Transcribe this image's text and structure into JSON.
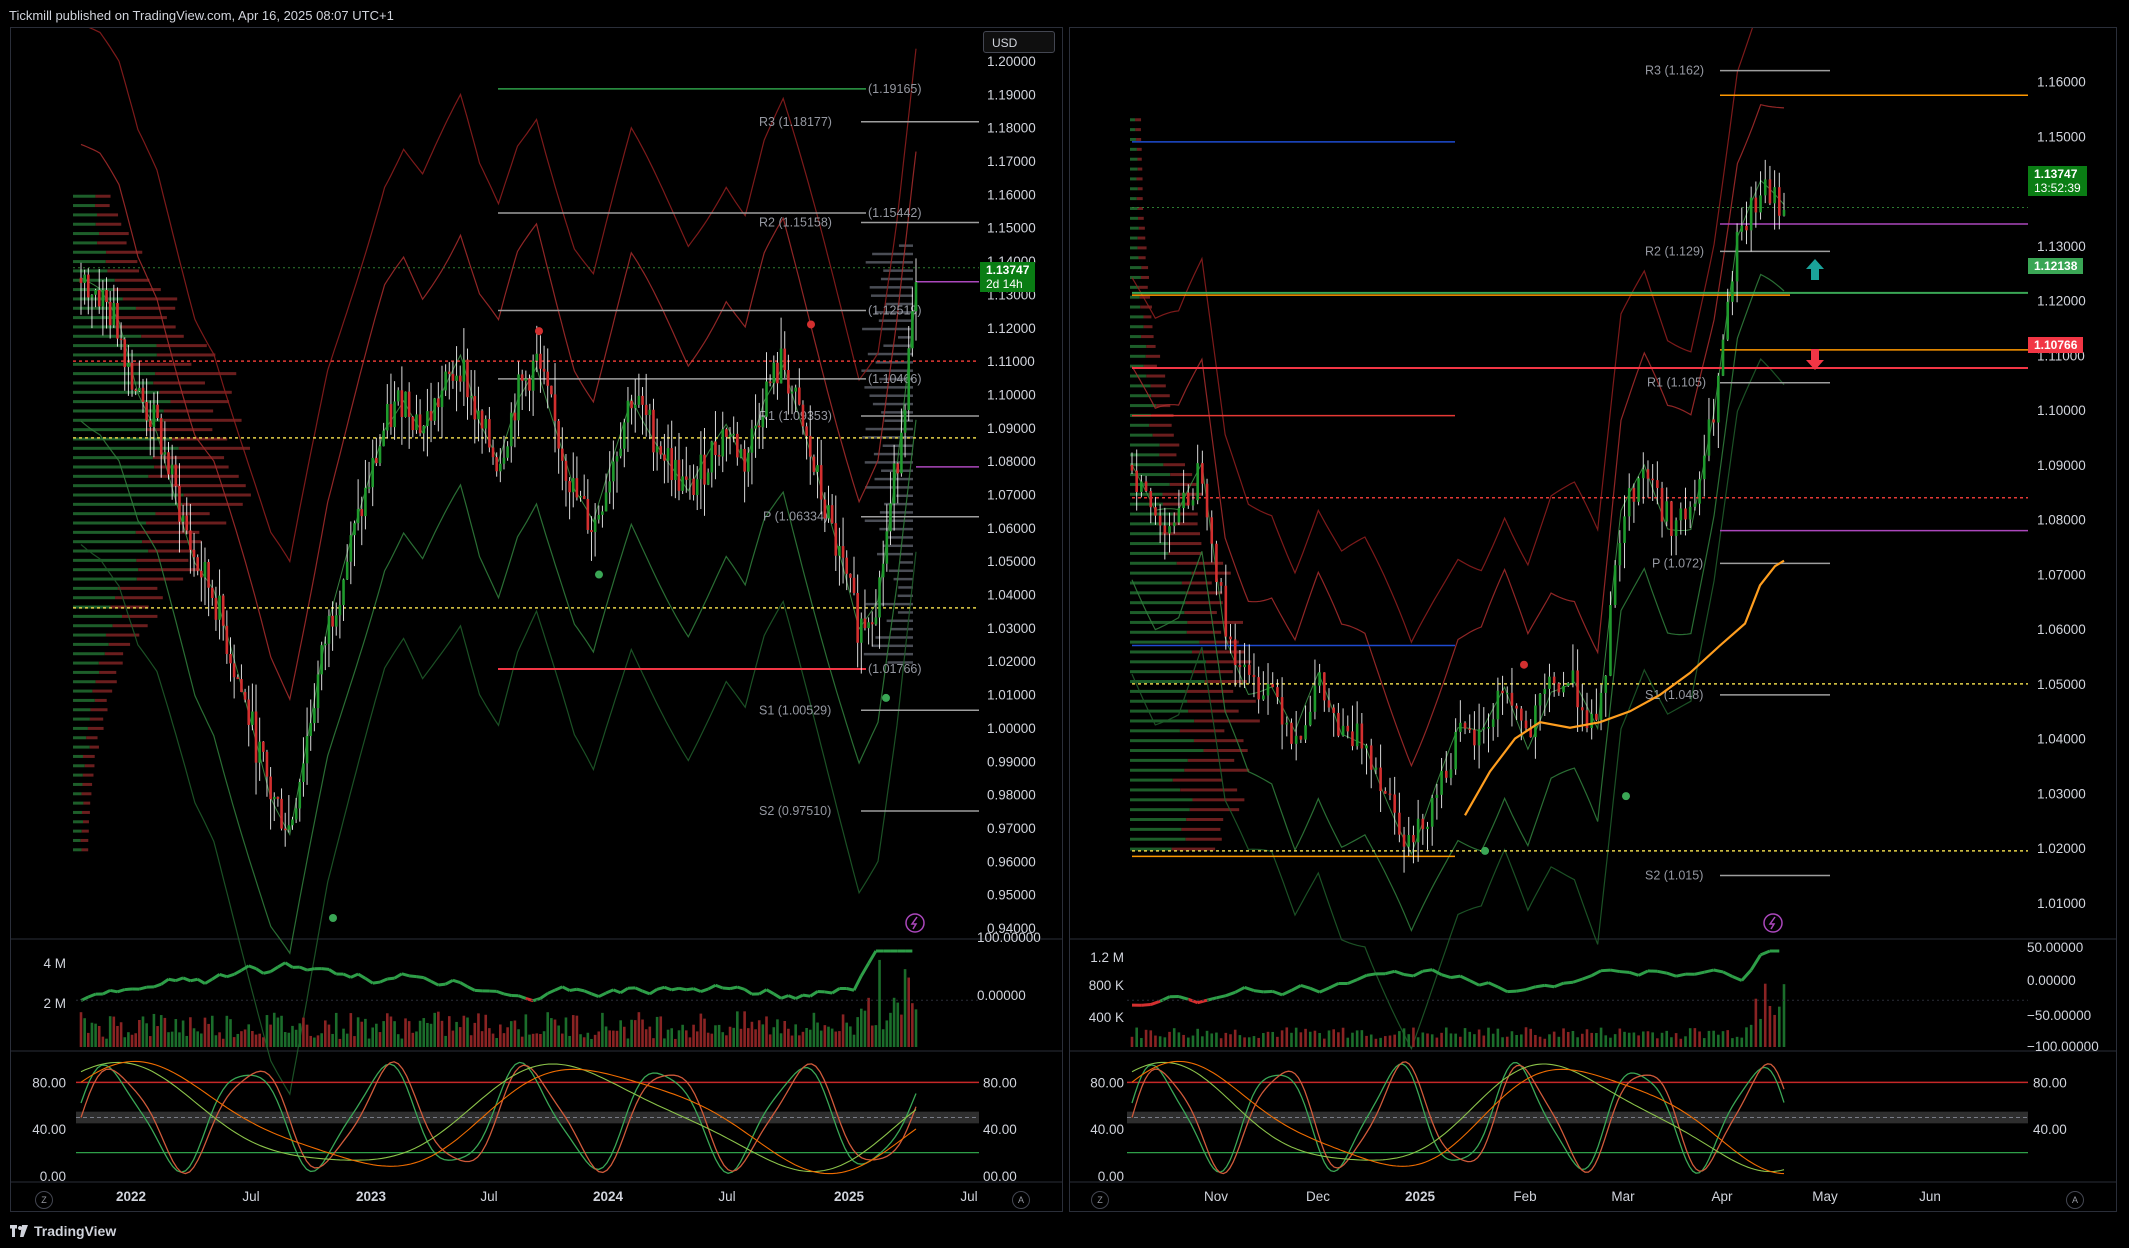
{
  "header": {
    "publisher": "Tickmill published on TradingView.com, Apr 16, 2025 08:07 UTC+1"
  },
  "footer": {
    "brand": "TradingView"
  },
  "left": {
    "currency": "USD",
    "price_tag": "1.13747",
    "countdown": "2d 14h",
    "ticks": [
      "1.20000",
      "1.19000",
      "1.18000",
      "1.17000",
      "1.16000",
      "1.15000",
      "1.14000",
      "1.13000",
      "1.12000",
      "1.11000",
      "1.10000",
      "1.09000",
      "1.08000",
      "1.07000",
      "1.06000",
      "1.05000",
      "1.04000",
      "1.03000",
      "1.02000",
      "1.01000",
      "1.00000",
      "0.99000",
      "0.98000",
      "0.97000",
      "0.96000",
      "0.95000",
      "0.94000"
    ],
    "levels": {
      "top": "(1.19165)",
      "r3": "R3 (1.18177)",
      "r2": "R2 (1.15158)",
      "r2b": "(1.15442)",
      "lvl2": "(1.12519)",
      "lvl3": "(1.10466)",
      "r1": "R1 (1.09353)",
      "p": "P (1.06334)",
      "low": "(1.01766)",
      "s1": "S1 (1.00529)",
      "s2": "S2 (0.97510)"
    },
    "vol_ticks": [
      "4 M",
      "2 M"
    ],
    "osc1_ticks": [
      "100.00000",
      "0.00000"
    ],
    "osc2_ticks": [
      "80.00",
      "40.00",
      "0.00"
    ],
    "osc2_ticks_r": [
      "80.00",
      "40.00",
      "00.00"
    ],
    "x_ticks": [
      "2022",
      "Jul",
      "2023",
      "Jul",
      "2024",
      "Jul",
      "2025",
      "Jul"
    ],
    "zoom_z": "Z",
    "zoom_a": "A"
  },
  "right": {
    "price_tag": "1.13747",
    "countdown": "13:52:39",
    "tag_green": "1.12138",
    "tag_red": "1.10766",
    "ticks": [
      "1.16000",
      "1.15000",
      "1.14000",
      "1.13000",
      "1.12000",
      "1.11000",
      "1.10000",
      "1.09000",
      "1.08000",
      "1.07000",
      "1.06000",
      "1.05000",
      "1.04000",
      "1.03000",
      "1.02000",
      "1.01000"
    ],
    "levels": {
      "r3": "R3 (1.162)",
      "r2": "R2 (1.129)",
      "r1": "R1 (1.105)",
      "p": "P (1.072)",
      "s1": "S1 (1.048)",
      "s2": "S2 (1.015)"
    },
    "vol_ticks": [
      "1.2 M",
      "800 K",
      "400 K"
    ],
    "osc1_ticks": [
      "50.00000",
      "0.00000",
      "−50.00000",
      "−100.00000"
    ],
    "osc2_ticks": [
      "80.00",
      "40.00",
      "0.00"
    ],
    "osc2_ticks_r": [
      "80.00",
      "40.00"
    ],
    "x_ticks": [
      "Nov",
      "Dec",
      "2025",
      "Feb",
      "Mar",
      "Apr",
      "May",
      "Jun"
    ],
    "zoom_z": "Z",
    "zoom_a": "A"
  },
  "colors": {
    "up": "#26a69a",
    "green": "#2e9e48",
    "red": "#e53935",
    "bg": "#000000",
    "grid": "#1a1d26",
    "purple": "#ab47bc",
    "orange": "#ff9800",
    "yellow": "#e6d34a"
  },
  "chart_data": [
    {
      "type": "candlestick",
      "title": "",
      "pane": "left",
      "ylim": [
        0.94,
        1.2
      ],
      "x": [
        "2022",
        "Jul",
        "2023",
        "Jul",
        "2024",
        "Jul",
        "2025",
        "Jul"
      ],
      "close_path": [
        1.135,
        1.13,
        1.12,
        1.1,
        1.09,
        1.07,
        1.05,
        1.04,
        1.02,
        1.0,
        0.98,
        0.97,
        1.0,
        1.03,
        1.05,
        1.07,
        1.09,
        1.1,
        1.09,
        1.1,
        1.11,
        1.09,
        1.08,
        1.1,
        1.11,
        1.09,
        1.07,
        1.06,
        1.08,
        1.1,
        1.09,
        1.08,
        1.07,
        1.08,
        1.09,
        1.08,
        1.1,
        1.11,
        1.09,
        1.07,
        1.05,
        1.03,
        1.04,
        1.08,
        1.13
      ]
    },
    {
      "type": "candlestick",
      "title": "",
      "pane": "right",
      "ylim": [
        1.005,
        1.165
      ],
      "x": [
        "Nov",
        "Dec",
        "2025",
        "Feb",
        "Mar",
        "Apr",
        "May",
        "Jun"
      ],
      "close_path": [
        1.09,
        1.08,
        1.08,
        1.09,
        1.06,
        1.05,
        1.05,
        1.04,
        1.05,
        1.04,
        1.04,
        1.03,
        1.02,
        1.03,
        1.04,
        1.04,
        1.05,
        1.04,
        1.05,
        1.05,
        1.04,
        1.08,
        1.09,
        1.08,
        1.08,
        1.1,
        1.13,
        1.14,
        1.137
      ]
    }
  ]
}
